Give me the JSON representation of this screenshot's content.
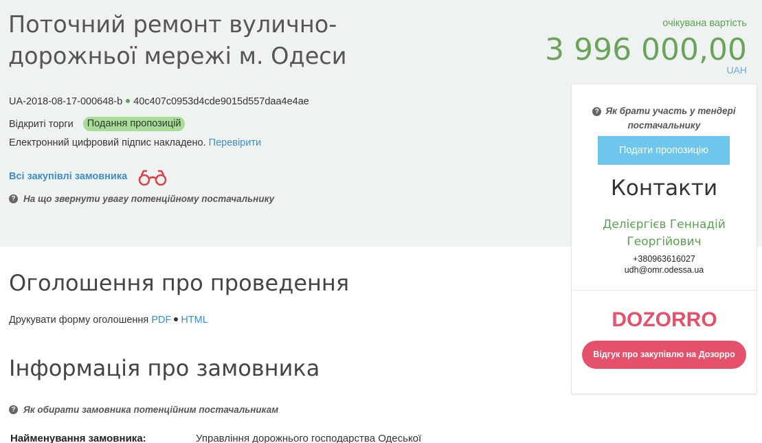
{
  "tender": {
    "title": "Поточний ремонт вулично-дорожньої мережі м. Одеси",
    "id": "UA-2018-08-17-000648-b",
    "hash": "40c407c0953d4cde9015d557daa4e4ae",
    "procedure_type": "Відкриті торги",
    "status": "Подання пропозицій",
    "signature_text": "Електронний цифровий підпис накладено.",
    "verify_link": "Перевірити"
  },
  "budget": {
    "label": "очікувана вартість",
    "value": "3 996 000,00",
    "currency": "UAH"
  },
  "links": {
    "all_purchases": "Всі закупівлі замовника",
    "attention_hint": "На що звернути увагу потенційному постачальнику"
  },
  "announcement": {
    "title": "Оголошення про проведення",
    "print_label": "Друкувати форму оголошення",
    "pdf": "PDF",
    "html": "HTML"
  },
  "customer": {
    "title": "Інформація про замовника",
    "hint": "Як обирати замовника потенційним постачальникам",
    "name_label": "Найменування замовника:",
    "name_value": "Управління дорожнього господарства Одеської"
  },
  "sidebar": {
    "hint": "Як брати участь у тендері постачальнику",
    "submit_button": "Подати пропозицію",
    "contacts_title": "Контакти",
    "contact_name": "Делієргієв Геннадій Георгійович",
    "phone": "+380963616027",
    "email": "udh@omr.odessa.ua",
    "dozorro_logo": "DOZORRO",
    "feedback_button": "Відгук про закупівлю на Дозорро"
  },
  "colors": {
    "hero_bg": "#eef3f1",
    "green": "#5aa150",
    "link_blue": "#3d8dc9",
    "submit_blue": "#6ec6ec",
    "dozorro_red": "#e5506a",
    "badge_green": "#a8dc98"
  },
  "icons": {
    "question": "question-circle-icon",
    "binoculars": "binoculars-icon"
  }
}
